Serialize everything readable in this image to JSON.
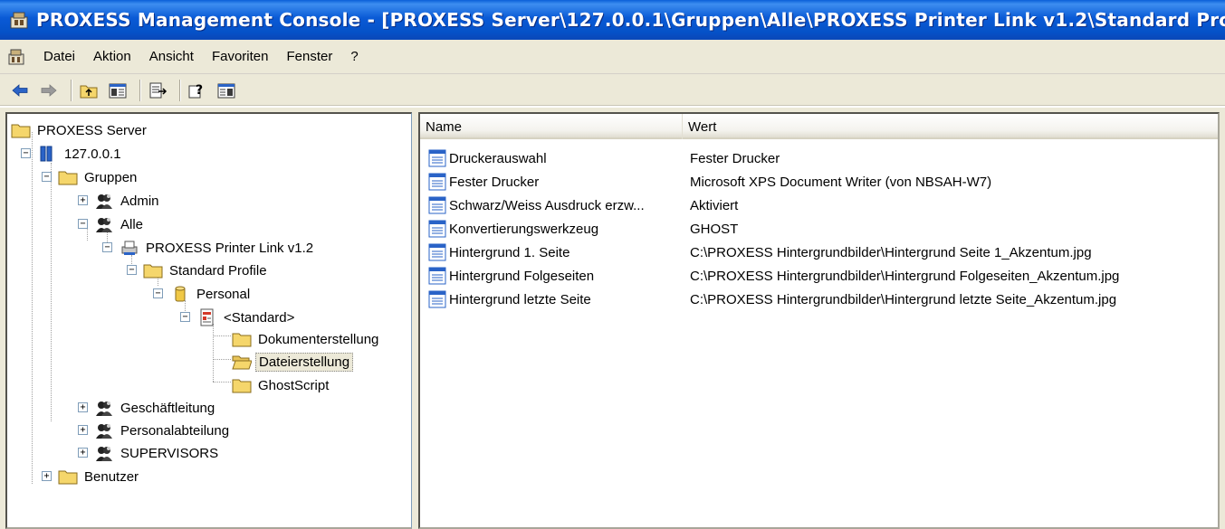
{
  "window": {
    "title": "PROXESS Management Console - [PROXESS Server\\127.0.0.1\\Gruppen\\Alle\\PROXESS Printer Link v1.2\\Standard Profile\\Personal\\<Standard>\\Dateierstellung]",
    "icon": "mmc-console-icon"
  },
  "menu": {
    "items": [
      "Datei",
      "Aktion",
      "Ansicht",
      "Favoriten",
      "Fenster",
      "?"
    ]
  },
  "toolbar": {
    "buttons": [
      "back-arrow-icon",
      "forward-arrow-icon",
      "up-folder-icon",
      "show-hide-tree-icon",
      "export-list-icon",
      "help-icon",
      "show-hide-action-pane-icon"
    ]
  },
  "tree": {
    "root": "PROXESS Server",
    "server": "127.0.0.1",
    "gruppen": "Gruppen",
    "admin": "Admin",
    "alle": "Alle",
    "printer_link": "PROXESS Printer Link v1.2",
    "standard_profile": "Standard Profile",
    "personal": "Personal",
    "standard": "<Standard>",
    "dokumenterstellung": "Dokumenterstellung",
    "dateierstellung": "Dateierstellung",
    "ghostscript": "GhostScript",
    "geschaeftleitung": "Geschäftleitung",
    "personalabteilung": "Personalabteilung",
    "supervisors": "SUPERVISORS",
    "benutzer": "Benutzer"
  },
  "list": {
    "columns": [
      "Name",
      "Wert"
    ],
    "rows": [
      {
        "name": "Druckerauswahl",
        "value": "Fester Drucker"
      },
      {
        "name": "Fester Drucker",
        "value": "Microsoft XPS Document Writer (von NBSAH-W7)"
      },
      {
        "name": "Schwarz/Weiss Ausdruck erzw...",
        "value": "Aktiviert"
      },
      {
        "name": "Konvertierungswerkzeug",
        "value": "GHOST"
      },
      {
        "name": "Hintergrund 1. Seite",
        "value": "C:\\PROXESS Hintergrundbilder\\Hintergrund Seite 1_Akzentum.jpg"
      },
      {
        "name": "Hintergrund Folgeseiten",
        "value": "C:\\PROXESS Hintergrundbilder\\Hintergrund Folgeseiten_Akzentum.jpg"
      },
      {
        "name": "Hintergrund letzte Seite",
        "value": "C:\\PROXESS Hintergrundbilder\\Hintergrund letzte Seite_Akzentum.jpg"
      }
    ]
  },
  "colors": {
    "titlebar": "#0a5ad6",
    "window_bg": "#ece9d8",
    "folder": "#f5d66b"
  }
}
